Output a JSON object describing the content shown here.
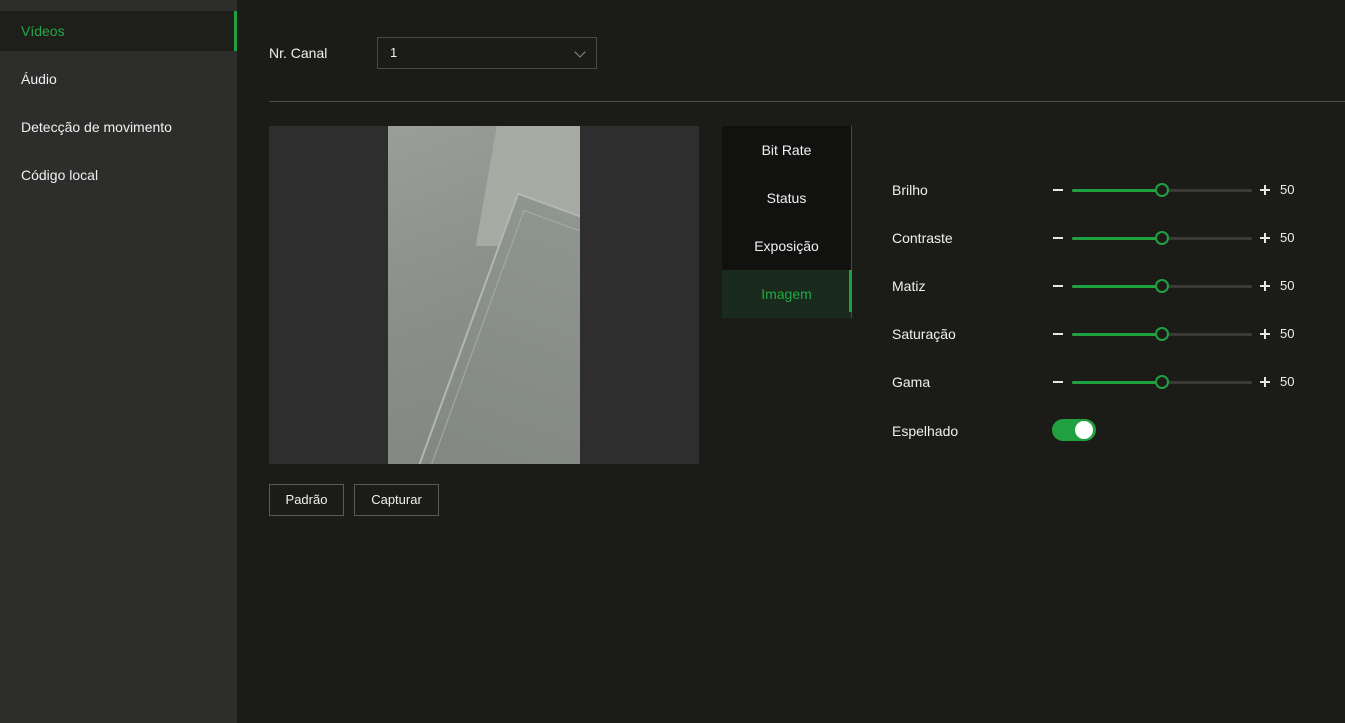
{
  "sidebar": {
    "items": [
      {
        "label": "Vídeos",
        "active": true
      },
      {
        "label": "Áudio",
        "active": false
      },
      {
        "label": "Detecção de movimento",
        "active": false
      },
      {
        "label": "Código local",
        "active": false
      }
    ]
  },
  "channel": {
    "label": "Nr. Canal",
    "value": "1"
  },
  "buttons": {
    "default_label": "Padrão",
    "capture_label": "Capturar"
  },
  "tabs": [
    {
      "label": "Bit Rate",
      "active": false
    },
    {
      "label": "Status",
      "active": false
    },
    {
      "label": "Exposição",
      "active": false
    },
    {
      "label": "Imagem",
      "active": true
    }
  ],
  "image_settings": {
    "sliders": [
      {
        "label": "Brilho",
        "value": 50,
        "fraction": 0.5
      },
      {
        "label": "Contraste",
        "value": 50,
        "fraction": 0.5
      },
      {
        "label": "Matiz",
        "value": 50,
        "fraction": 0.5
      },
      {
        "label": "Saturação",
        "value": 50,
        "fraction": 0.5
      },
      {
        "label": "Gama",
        "value": 50,
        "fraction": 0.5
      }
    ],
    "mirror": {
      "label": "Espelhado",
      "on": true
    }
  },
  "colors": {
    "accent": "#21a03f",
    "sidebar_bg": "#2d2e2b",
    "main_bg": "#1b1c17"
  }
}
